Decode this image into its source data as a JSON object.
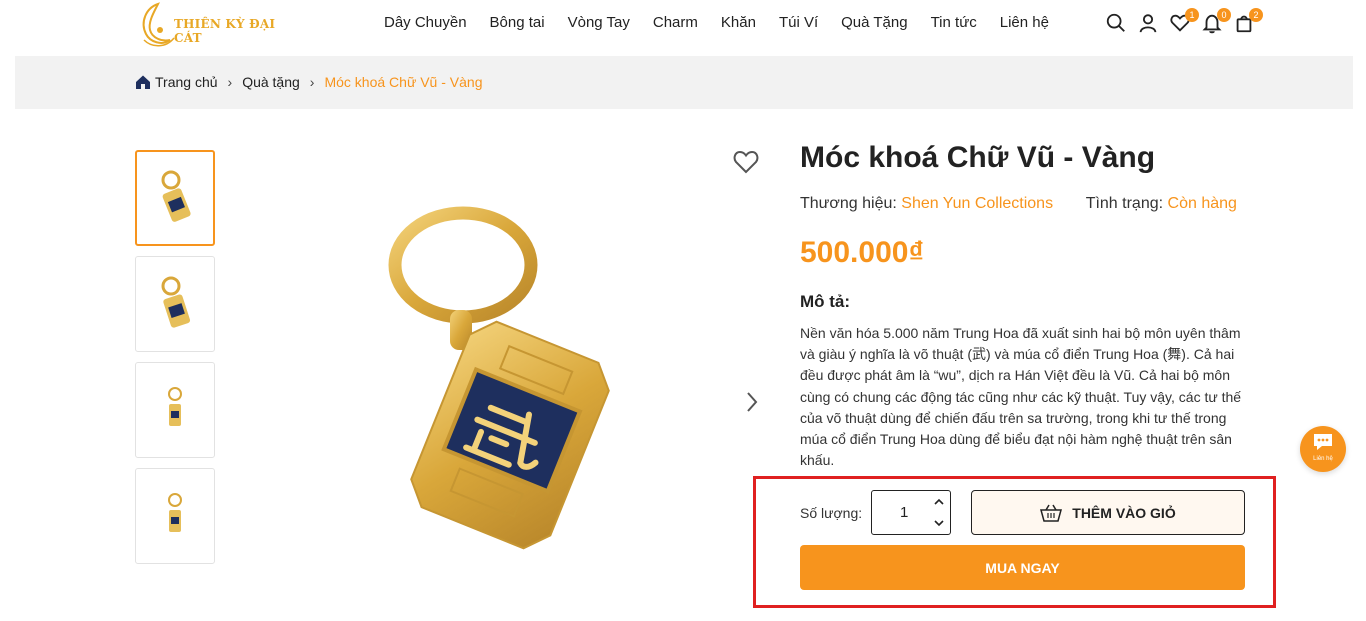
{
  "header": {
    "logo_text": "THIÊN KỲ ĐẠI CÁT",
    "nav": [
      "Dây Chuyền",
      "Bông tai",
      "Vòng Tay",
      "Charm",
      "Khăn",
      "Túi Ví",
      "Quà Tặng",
      "Tin tức",
      "Liên hệ"
    ],
    "badges": {
      "wishlist": "1",
      "notifications": "0",
      "cart": "2"
    }
  },
  "breadcrumb": {
    "home": "Trang chủ",
    "category": "Quà tặng",
    "current": "Móc khoá Chữ Vũ - Vàng"
  },
  "product": {
    "title": "Móc khoá Chữ Vũ - Vàng",
    "brand_label": "Thương hiệu:",
    "brand": "Shen Yun Collections",
    "status_label": "Tình trạng:",
    "status": "Còn hàng",
    "price": "500.000₫",
    "desc_title": "Mô tả:",
    "description": "Nền văn hóa 5.000 năm Trung Hoa đã xuất sinh hai bộ môn uyên thâm và giàu ý nghĩa là võ thuật (武) và múa cổ điển Trung Hoa (舞). Cả hai đều được phát âm là “wu”, dịch ra Hán Việt đều là Vũ. Cả hai bộ môn cùng có chung các động tác cũng như các kỹ thuật. Tuy vậy, các tư thế của võ thuật dùng để chiến đấu trên sa trường, trong khi tư thế trong múa cổ điển Trung Hoa dùng để biểu đạt nội hàm nghệ thuật trên sân khấu."
  },
  "purchase": {
    "qty_label": "Số lượng:",
    "qty_value": "1",
    "add_to_cart": "THÊM VÀO GIỎ",
    "buy_now": "MUA NGAY"
  },
  "contact": {
    "label": "Liên hệ"
  },
  "colors": {
    "accent": "#f7941d",
    "highlight": "#e02020",
    "navy": "#1e2f5e",
    "gold": "#d9a73a"
  }
}
